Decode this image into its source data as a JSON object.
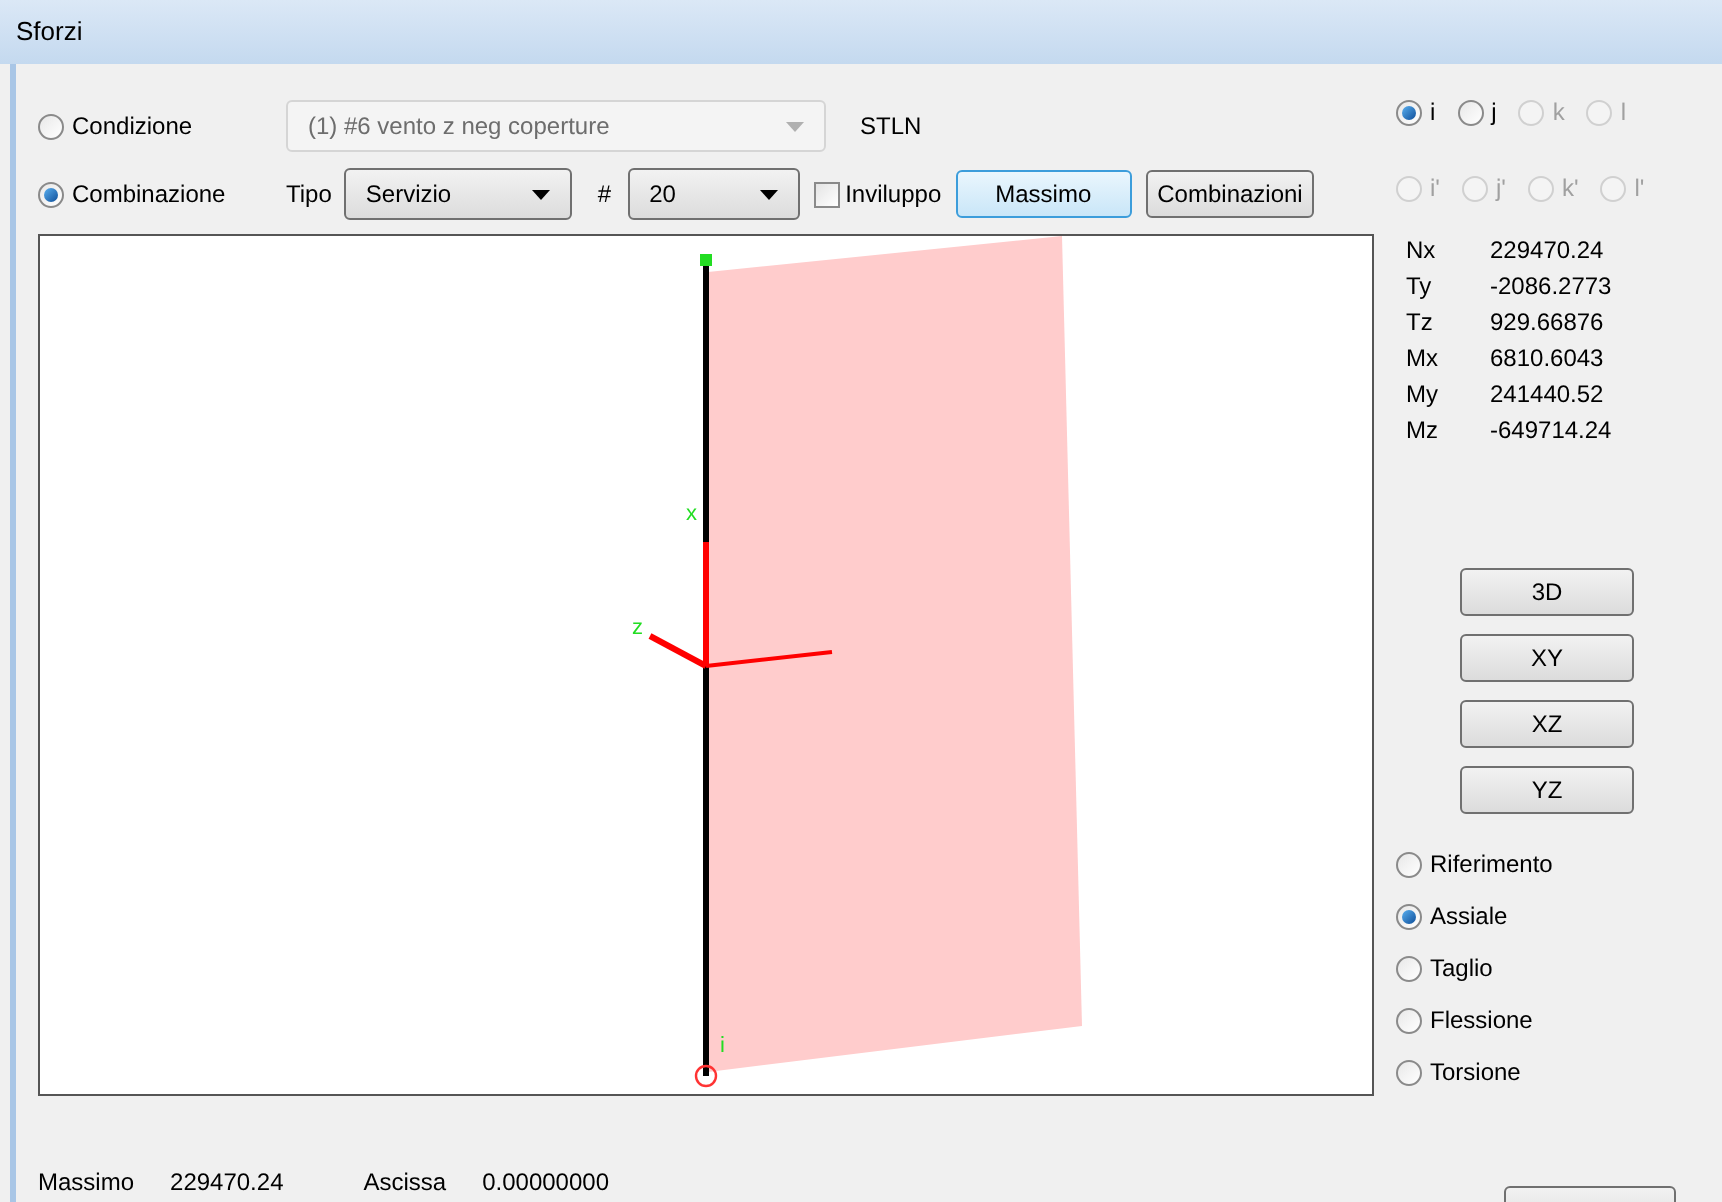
{
  "window": {
    "title": "Sforzi"
  },
  "source": [
    {
      "label": "Condizione",
      "selected": false
    },
    {
      "label": "Combinazione",
      "selected": true
    }
  ],
  "condition_dropdown": {
    "value": "(1) #6 vento z neg coperture",
    "disabled": true
  },
  "element_label": "STLN",
  "tipo": {
    "label": "Tipo",
    "value": "Servizio"
  },
  "number": {
    "label": "#",
    "value": "20"
  },
  "inviluppo": {
    "label": "Inviluppo",
    "checked": false
  },
  "buttons": [
    {
      "label": "Massimo",
      "focused": true
    },
    {
      "label": "Combinazioni",
      "focused": false
    }
  ],
  "nodes": [
    [
      {
        "label": "i",
        "selected": true,
        "disabled": false
      },
      {
        "label": "j",
        "selected": false,
        "disabled": false
      },
      {
        "label": "k",
        "selected": false,
        "disabled": true
      },
      {
        "label": "l",
        "selected": false,
        "disabled": true
      }
    ],
    [
      {
        "label": "i'",
        "selected": false,
        "disabled": true
      },
      {
        "label": "j'",
        "selected": false,
        "disabled": true
      },
      {
        "label": "k'",
        "selected": false,
        "disabled": true
      },
      {
        "label": "l'",
        "selected": false,
        "disabled": true
      }
    ]
  ],
  "forces": [
    {
      "name": "Nx",
      "value": "229470.24"
    },
    {
      "name": "Ty",
      "value": "-2086.2773"
    },
    {
      "name": "Tz",
      "value": "929.66876"
    },
    {
      "name": "Mx",
      "value": "6810.6043"
    },
    {
      "name": "My",
      "value": "241440.52"
    },
    {
      "name": "Mz",
      "value": "-649714.24"
    }
  ],
  "views": [
    "3D",
    "XY",
    "XZ",
    "YZ"
  ],
  "diagrams": [
    {
      "label": "Riferimento",
      "selected": false
    },
    {
      "label": "Assiale",
      "selected": true
    },
    {
      "label": "Taglio",
      "selected": false
    },
    {
      "label": "Flessione",
      "selected": false
    },
    {
      "label": "Torsione",
      "selected": false
    }
  ],
  "viewport": {
    "labels": [
      "x",
      "z",
      "i"
    ]
  },
  "status": [
    {
      "label": "Massimo",
      "value": "229470.24"
    },
    {
      "label": "Ascissa",
      "value": "0.00000000"
    }
  ]
}
